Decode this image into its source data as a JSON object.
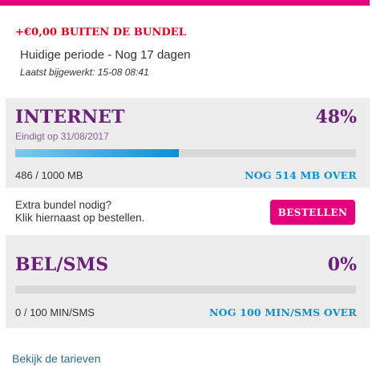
{
  "colors": {
    "brand_pink": "#e4007c",
    "extra_red": "#e2001a",
    "title_purple": "#6a1f78",
    "accent_blue": "#0a8fd6"
  },
  "summary": {
    "extra_cost": "+€0,00 BUITEN DE BUNDEL",
    "period": "Huidige periode - Nog 17 dagen",
    "last_updated": "Laatst bijgewerkt: 15-08 08:41"
  },
  "internet": {
    "title": "INTERNET",
    "percent_label": "48%",
    "percent": 48,
    "expires": "Eindigt op 31/08/2017",
    "usage": "486 / 1000 MB",
    "remaining": "NOG 514 MB OVER"
  },
  "order": {
    "line1": "Extra bundel nodig?",
    "line2": "Klik hiernaast op bestellen.",
    "button_label": "BESTELLEN"
  },
  "bel_sms": {
    "title": "BEL/SMS",
    "percent_label": "0%",
    "percent": 0,
    "usage": "0 / 100 MIN/SMS",
    "remaining": "NOG 100 MIN/SMS OVER"
  },
  "footer": {
    "tariffs_link": "Bekijk de tarieven"
  }
}
